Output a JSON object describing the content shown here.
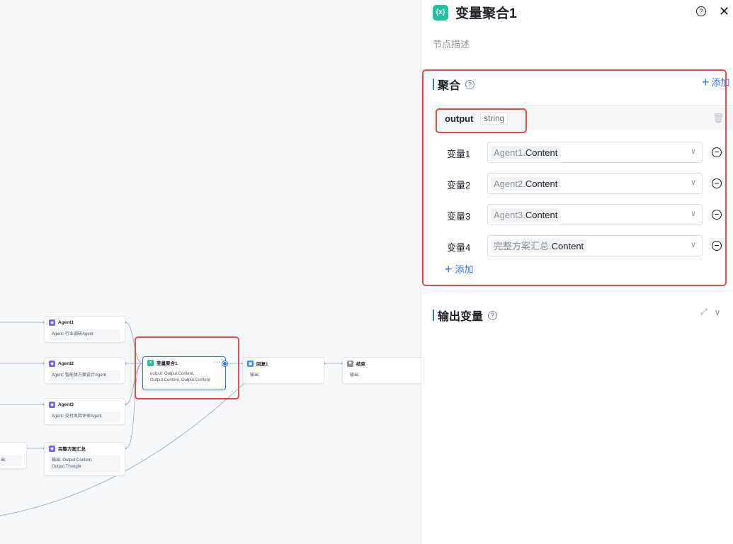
{
  "canvas": {
    "nodes": {
      "agent1": {
        "title": "Agent1",
        "sub": "Agent: 行业调研Agent"
      },
      "agent2": {
        "title": "Agent2",
        "sub": "Agent: 智能体方案设计Agent"
      },
      "agent3": {
        "title": "Agent3",
        "sub": "Agent: 交付风险评审Agent"
      },
      "summary": {
        "title": "完整方案汇总",
        "sub_line1": "输出:  Output.Content,",
        "sub_line2": "Output.Thought"
      },
      "aggregator": {
        "title": "变量聚合1",
        "sub_line1": "output:  Output.Content,",
        "sub_line2": "Output.Content,  Output.Content"
      },
      "reply": {
        "title": "回复1",
        "sub": "输出:"
      },
      "end": {
        "title": "结束",
        "sub": "输出:"
      },
      "left_partial": {
        "sub": "出:"
      }
    }
  },
  "panel": {
    "title": "变量聚合1",
    "icon_glyph": "{x}",
    "help_glyph": "?",
    "close_glyph": "✕",
    "description_placeholder": "节点描述",
    "aggregate_section": {
      "title": "聚合",
      "add_label": "添加",
      "group": {
        "name": "output",
        "type": "string",
        "variables": [
          {
            "label": "变量1",
            "source": "Agent1.",
            "field": "Content"
          },
          {
            "label": "变量2",
            "source": "Agent2.",
            "field": "Content"
          },
          {
            "label": "变量3",
            "source": "Agent3.",
            "field": "Content"
          },
          {
            "label": "变量4",
            "source": "完整方案汇总.",
            "field": "Content"
          }
        ],
        "add_variable_label": "添加"
      }
    },
    "output_section": {
      "title": "输出变量"
    }
  },
  "colors": {
    "accent": "#3370ff",
    "highlight_box": "#e84a4a",
    "aggregator_icon": "#20c2a0",
    "agent_icon": "#7b61ff"
  }
}
